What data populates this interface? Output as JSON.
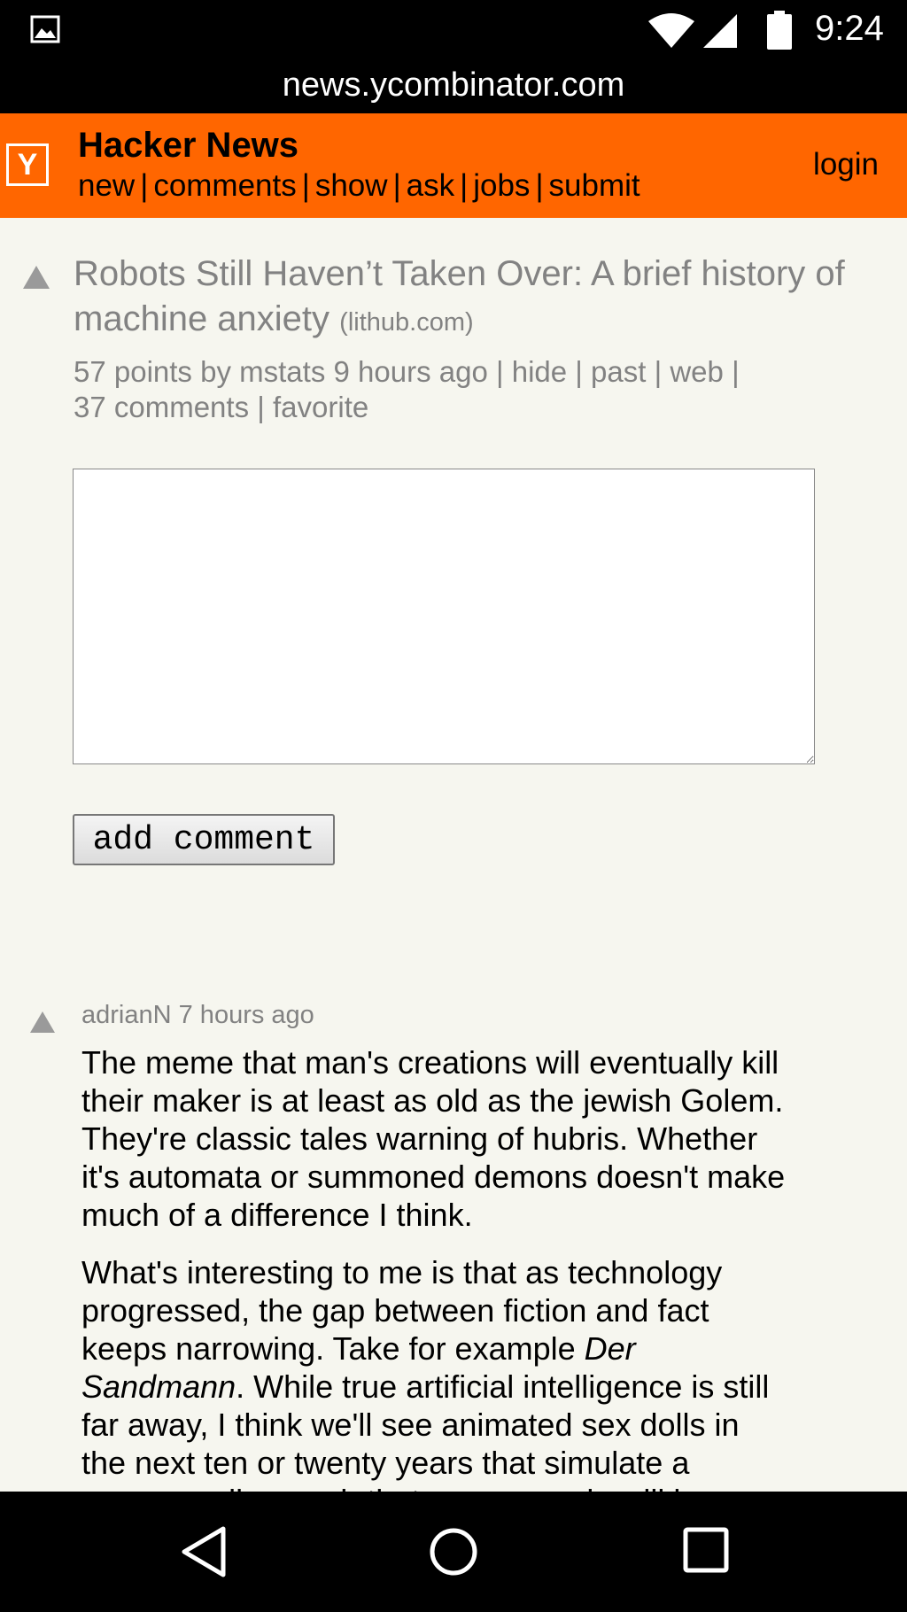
{
  "status_bar": {
    "time": "9:24"
  },
  "url_bar": {
    "url": "news.ycombinator.com"
  },
  "header": {
    "logo_letter": "Y",
    "title": "Hacker News",
    "nav": [
      "new",
      "comments",
      "show",
      "ask",
      "jobs",
      "submit"
    ],
    "separator": "|",
    "login": "login"
  },
  "story": {
    "title": "Robots Still Haven’t Taken Over: A brief history of machine anxiety",
    "domain": "(lithub.com)",
    "points": "57 points",
    "by": "by",
    "user": "mstats",
    "age": "9 hours ago",
    "hide": "hide",
    "past": "past",
    "web": "web",
    "comments": "37 comments",
    "favorite": "favorite",
    "sep": "|"
  },
  "reply": {
    "textarea_value": "",
    "button_label": "add comment"
  },
  "comment": {
    "user": "adrianN",
    "age": "7 hours ago",
    "p1": "The meme that man's creations will eventually kill their maker is at least as old as the jewish Golem. They're classic tales warning of hubris. Whether it's automata or summoned demons doesn't make much of a difference I think.",
    "p2_a": "What's interesting to me is that as technology progressed, the gap between fiction and fact keeps narrowing. Take for example ",
    "p2_em": "Der Sandmann",
    "p2_b": ". While true artificial intelligence is still far away, I think we'll see animated sex dolls in the next ten or twenty years that simulate a person well enough that some people will be fooled."
  },
  "icons": {
    "gallery": "gallery-icon",
    "wifi": "wifi-icon",
    "signal": "signal-icon",
    "battery": "battery-icon",
    "upvote": "upvote-arrow-icon",
    "back": "back-icon",
    "home": "home-icon",
    "recents": "recents-icon"
  },
  "colors": {
    "header": "#ff6600",
    "background": "#f6f6ef",
    "subtext": "#828282"
  }
}
